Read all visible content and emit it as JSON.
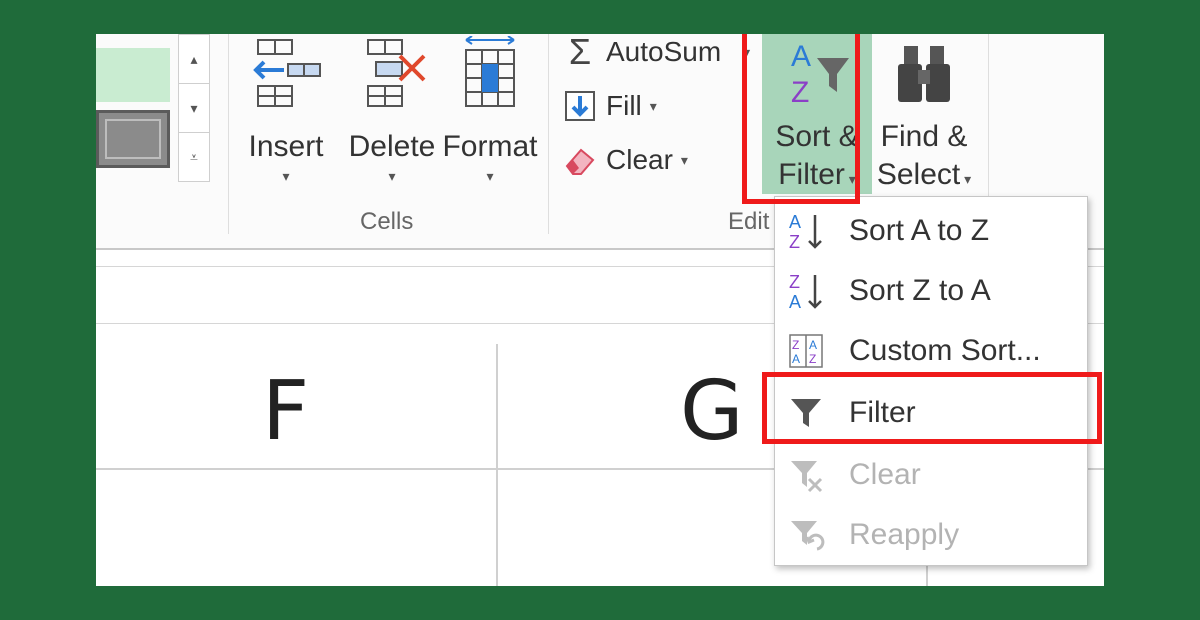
{
  "ribbon": {
    "cells_group": {
      "label": "Cells",
      "insert": "Insert",
      "delete": "Delete",
      "format": "Format"
    },
    "editing_group": {
      "label": "Edit",
      "autosum": "AutoSum",
      "fill": "Fill",
      "clear": "Clear",
      "sort_filter_line1": "Sort &",
      "sort_filter_line2": "Filter",
      "find_select_line1": "Find &",
      "find_select_line2": "Select"
    }
  },
  "sheet": {
    "columns": [
      "F",
      "G"
    ]
  },
  "dropdown": {
    "items": [
      {
        "label": "Sort A to Z",
        "icon": "sort-a-to-z-icon",
        "enabled": true
      },
      {
        "label": "Sort Z to A",
        "icon": "sort-z-to-a-icon",
        "enabled": true
      },
      {
        "label": "Custom Sort...",
        "icon": "custom-sort-icon",
        "enabled": true
      },
      {
        "label": "Filter",
        "icon": "filter-icon",
        "enabled": true,
        "highlighted": true
      },
      {
        "label": "Clear",
        "icon": "clear-filter-icon",
        "enabled": false
      },
      {
        "label": "Reapply",
        "icon": "reapply-icon",
        "enabled": false
      }
    ]
  },
  "colors": {
    "background": "#1f6b3a",
    "highlight": "#ef1a1a",
    "sort_filter_bg": "#a8d5ba",
    "purple": "#8b3fc7",
    "blue": "#2b7bd6"
  }
}
